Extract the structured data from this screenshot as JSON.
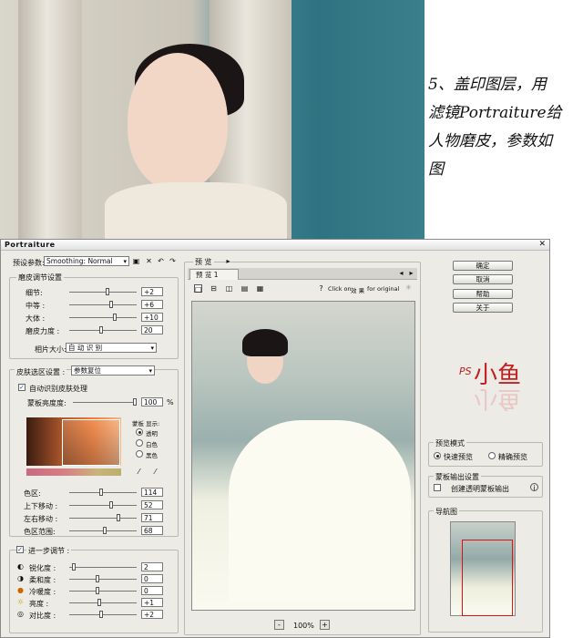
{
  "caption": {
    "lines": [
      "5、盖印图层，用",
      "滤镜Portraiture给",
      "人物磨皮，参数如",
      "图"
    ]
  },
  "window": {
    "title": "Portraiture"
  },
  "preset": {
    "label": "预设参数:",
    "value": "Smoothing: Normal"
  },
  "detail_smoothing": {
    "title": "磨皮调节设置",
    "sliders": [
      {
        "label": "细节:",
        "value": "+2",
        "level": 0.55
      },
      {
        "label": "中等 :",
        "value": "+6",
        "level": 0.6
      },
      {
        "label": "大体 :",
        "value": "+10",
        "level": 0.65
      },
      {
        "label": "磨皮力度 :",
        "value": "20",
        "level": 0.45
      }
    ],
    "size_label": "相片大小:",
    "size_value": "自 动 识 别"
  },
  "skin_mask": {
    "title": "皮肤选区设置 :",
    "reset": "参数复位",
    "auto_label": "自动识别皮肤处理",
    "opacity_label": "蒙板亮度度:",
    "opacity_value": "100",
    "opacity_unit": "%",
    "mask_preview_label": "蒙板 显示:",
    "mask_options": [
      "透明",
      "白色",
      "黑色"
    ],
    "sliders": [
      {
        "label": "色区:",
        "value": "114",
        "level": 0.45
      },
      {
        "label": "上下移动 :",
        "value": "52",
        "level": 0.6
      },
      {
        "label": "左右移动 :",
        "value": "71",
        "level": 0.7
      },
      {
        "label": "色区范围:",
        "value": "68",
        "level": 0.5
      }
    ]
  },
  "enhancements": {
    "title": "进一步调节 :",
    "sliders": [
      {
        "label": "锐化度 :",
        "value": "2",
        "level": 0.05
      },
      {
        "label": "柔和度 :",
        "value": "0",
        "level": 0.4
      },
      {
        "label": "冷暖度 :",
        "value": "0",
        "level": 0.4
      },
      {
        "label": "亮度 :",
        "value": "+1",
        "level": 0.42
      },
      {
        "label": "对比度 :",
        "value": "+2",
        "level": 0.44
      }
    ]
  },
  "preview": {
    "group_title": "预 览",
    "tab": "预 览 1",
    "click_hint": "Click on",
    "click_hint2": "效 果",
    "click_hint3": "for original",
    "zoom": "100%"
  },
  "actions": {
    "ok": "确定",
    "cancel": "取消",
    "help": "帮助",
    "about": "关于"
  },
  "preview_mode": {
    "title": "预览模式",
    "fast": "快速预览",
    "accurate": "精确预览"
  },
  "mask_output": {
    "title": "蒙板输出设置",
    "create": "创建透明蒙板输出"
  },
  "navigator": {
    "title": "导航图"
  },
  "logo": {
    "text": "小鱼",
    "prefix": "PS"
  }
}
